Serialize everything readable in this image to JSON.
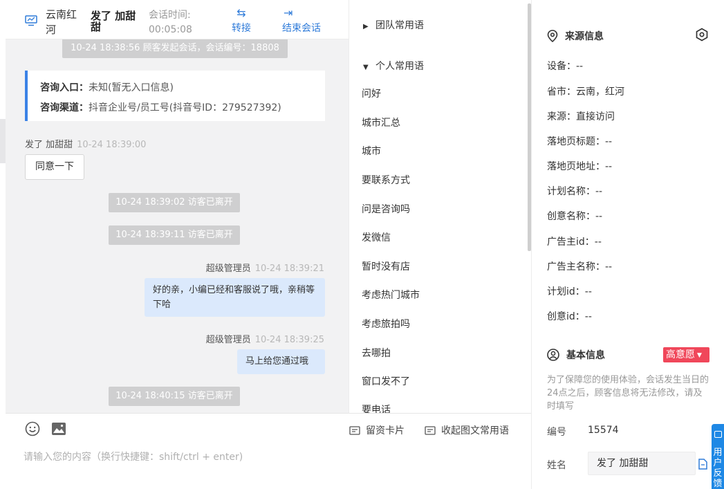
{
  "header": {
    "location": "云南红河",
    "visitor_name": "发了 加甜甜",
    "session_time_label": "会话时间:",
    "session_time": "00:05:08",
    "transfer_label": "转接",
    "end_session_label": "结束会话"
  },
  "messages": {
    "session_start": "10-24 18:38:56 顾客发起会话，会话编号：18808",
    "entry_label": "咨询入口：",
    "entry_value": "未知(暂无入口信息)",
    "channel_label": "咨询渠道：",
    "channel_value": "抖音企业号/员工号(抖音号ID：279527392)",
    "visitor_sender": "发了 加甜甜",
    "visitor_time": "10-24 18:39:00",
    "visitor_text": "同意一下",
    "leave_1": "10-24 18:39:02 访客已离开",
    "leave_2": "10-24 18:39:11 访客已离开",
    "agent_name_1": "超级管理员",
    "agent_time_1": "10-24 18:39:21",
    "agent_text_1": "好的亲，小编已经和客服说了哦，亲稍等下哈",
    "agent_name_2": "超级管理员",
    "agent_time_2": "10-24 18:39:25",
    "agent_text_2": "马上给您通过哦",
    "leave_3": "10-24 18:40:15 访客已离开"
  },
  "input": {
    "placeholder": "请输入您的内容（换行快捷键：shift/ctrl + enter)",
    "card_label": "留资卡片",
    "collapse_label": "收起图文常用语"
  },
  "phrases": {
    "team_group": "团队常用语",
    "personal_group": "个人常用语",
    "items": [
      "问好",
      "城市汇总",
      "城市",
      "要联系方式",
      "问是咨询吗",
      "发微信",
      "暂时没有店",
      "考虑热门城市",
      "考虑旅拍吗",
      "去哪拍",
      "窗口发不了",
      "要电话"
    ]
  },
  "info": {
    "source_title": "来源信息",
    "device": "设备：--",
    "province": "省市：云南，红河",
    "source": "来源：直接访问",
    "landing_title": "落地页标题：--",
    "landing_url": "落地页地址：--",
    "plan_name": "计划名称：--",
    "creative_name": "创意名称：--",
    "advertiser_id": "广告主id：--",
    "advertiser_name": "广告主名称：--",
    "plan_id": "计划id：--",
    "creative_id": "创意id：--",
    "basic_title": "基本信息",
    "intent_badge": "高意愿",
    "basic_note": "为了保障您的使用体验，会话发生当日的24点之后，顾客信息将无法修改，请及时填写",
    "id_label": "编号",
    "id_value": "15574",
    "name_label": "姓名",
    "name_value": "发了 加甜甜",
    "feedback_label": "用户反馈"
  },
  "colors": {
    "accent": "#2f7bd9",
    "agent_bubble": "#dbe9fc",
    "intent_badge": "#f0475a",
    "system_pill": "#cfcfd0"
  }
}
